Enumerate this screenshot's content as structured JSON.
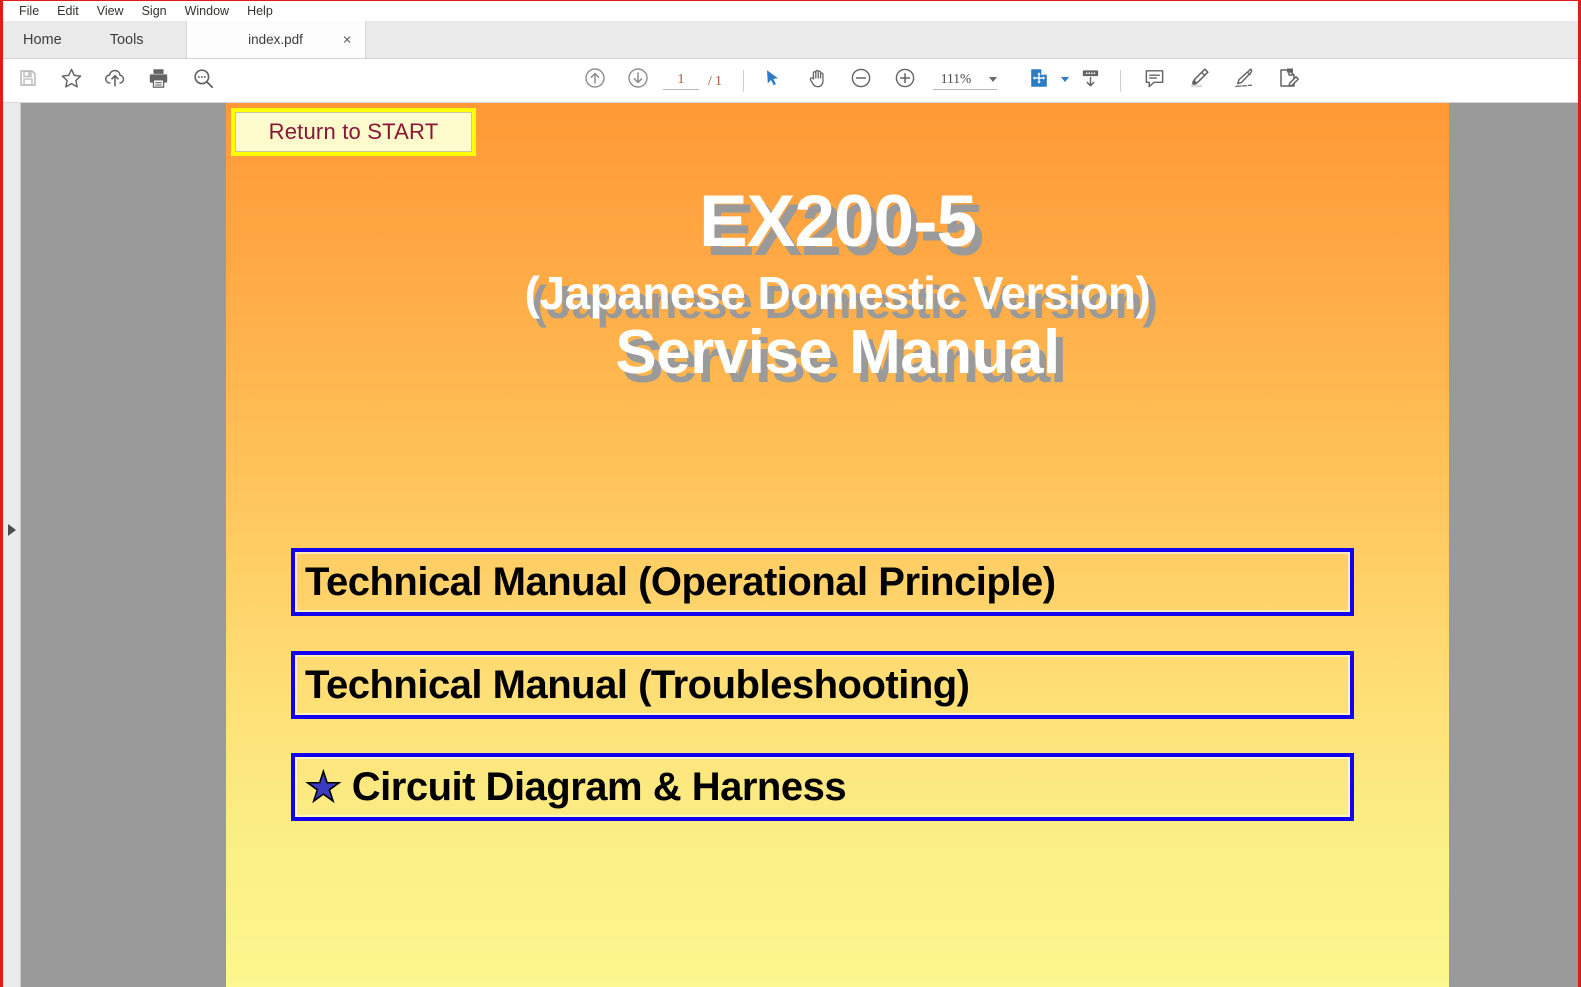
{
  "window": {
    "border_color": "#e01b1b"
  },
  "menu": {
    "items": [
      {
        "label": "File"
      },
      {
        "label": "Edit"
      },
      {
        "label": "View"
      },
      {
        "label": "Sign"
      },
      {
        "label": "Window"
      },
      {
        "label": "Help"
      }
    ]
  },
  "tabs": {
    "home_label": "Home",
    "tools_label": "Tools",
    "document_label": "index.pdf",
    "close_glyph": "×"
  },
  "toolbar": {
    "icons": [
      {
        "name": "save-icon",
        "title": "Save file"
      },
      {
        "name": "star-icon",
        "title": "Add to favorites"
      },
      {
        "name": "cloud-upload-icon",
        "title": "Upload to cloud"
      },
      {
        "name": "print-icon",
        "title": "Print file"
      },
      {
        "name": "search-icon",
        "title": "Find text"
      },
      {
        "name": "previous-page-icon",
        "title": "Previous page"
      },
      {
        "name": "next-page-icon",
        "title": "Next page"
      },
      {
        "name": "select-tool-icon",
        "title": "Select tool"
      },
      {
        "name": "hand-tool-icon",
        "title": "Hand tool"
      },
      {
        "name": "zoom-out-icon",
        "title": "Zoom out"
      },
      {
        "name": "zoom-in-icon",
        "title": "Zoom in"
      },
      {
        "name": "fit-page-icon",
        "title": "Fit page"
      },
      {
        "name": "scroll-mode-icon",
        "title": "Page display"
      },
      {
        "name": "comment-icon",
        "title": "Add comment"
      },
      {
        "name": "highlight-icon",
        "title": "Highlight text"
      },
      {
        "name": "signature-icon",
        "title": "Sign"
      },
      {
        "name": "fill-and-sign-icon",
        "title": "Fill & Sign"
      }
    ],
    "page_current": "1",
    "page_total": "/ 1",
    "page_placeholder": "1",
    "zoom_level": "111%"
  },
  "document": {
    "return_button_label": "Return to START",
    "title_main": "EX200-5",
    "title_sub": "(Japanese Domestic Version)",
    "title_type": "Servise Manual",
    "links": [
      {
        "label": "Technical Manual (Operational Principle)",
        "has_star": false
      },
      {
        "label": "Technical Manual (Troubleshooting)",
        "has_star": false
      },
      {
        "label": "Circuit Diagram & Harness",
        "has_star": true,
        "star_glyph": "★"
      }
    ],
    "colors": {
      "gradient_top": "#ff9936",
      "gradient_bottom": "#fcf78e",
      "link_border": "#1200ee",
      "return_border": "#ffff00",
      "return_text": "#8b1538",
      "star": "#3b3bc0",
      "title_text": "#ffffff",
      "title_shadow": "#9a9a9a"
    }
  },
  "sidebar": {
    "expand_label": "Show navigation pane"
  }
}
